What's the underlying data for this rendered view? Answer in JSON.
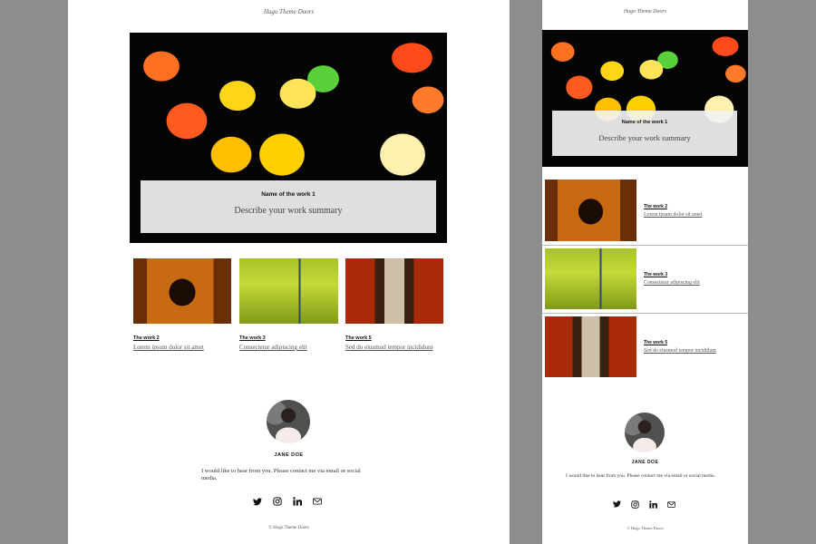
{
  "site": {
    "title": "Hugo Theme Doors",
    "footer": "© Hugo Theme Doors"
  },
  "featured": {
    "name": "Name of the work 1",
    "summary": "Describe your work summary"
  },
  "works": [
    {
      "name": "The work 2",
      "summary": "Lorem ipsum dolor sit amet",
      "image": "demon-painting"
    },
    {
      "name": "The work 3",
      "summary": "Consectetur adipiscing elit",
      "image": "rice-field-heron"
    },
    {
      "name": "The work 5",
      "summary": "Sed do eiusmod tempor incididunt",
      "image": "torii-gates-path"
    }
  ],
  "profile": {
    "name": "JANE DOE",
    "contact": "I would like to hear from you. Please contact me via email or social media."
  },
  "social_icons": [
    "twitter-icon",
    "instagram-icon",
    "linkedin-icon",
    "mail-icon"
  ],
  "colors": {
    "backdrop": "#8d8d8d",
    "page": "#ffffff",
    "text": "#222222",
    "overlay": "#f2f2f2"
  }
}
